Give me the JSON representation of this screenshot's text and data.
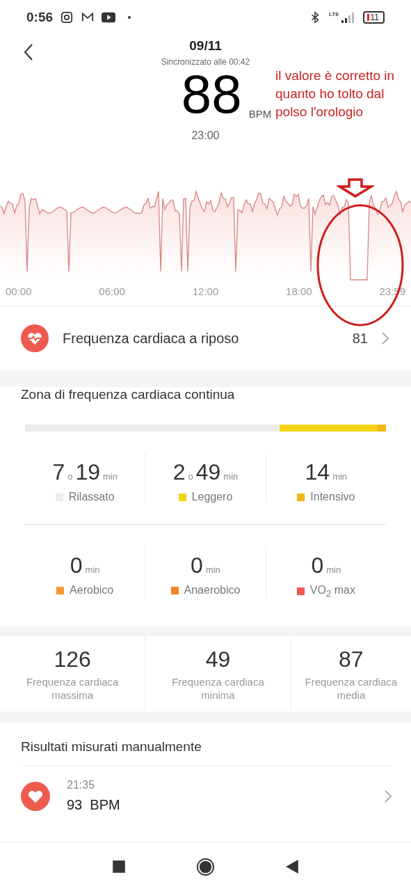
{
  "status_bar": {
    "time": "0:56",
    "network": "LTE",
    "battery": "11"
  },
  "header": {
    "date": "09/11",
    "sync": "Sincronizzato alle 00:42",
    "bpm": "88",
    "unit": "BPM",
    "time": "23:00"
  },
  "annotation": {
    "text": "il valore è corretto in quanto ho tolto dal polso l'orologio"
  },
  "chart": {
    "x_labels": [
      "00:00",
      "06:00",
      "12:00",
      "18:00",
      "23:59"
    ]
  },
  "resting": {
    "label": "Frequenza cardiaca a riposo",
    "value": "81"
  },
  "zones": {
    "title": "Zona di frequenza cardiaca continua",
    "items": [
      {
        "label": "Rilassato",
        "color": "#ececec",
        "parts": [
          {
            "kind": "number",
            "text": "7"
          },
          {
            "kind": "unit",
            "text": "o"
          },
          {
            "kind": "number",
            "text": "19"
          },
          {
            "kind": "unit",
            "text": "min"
          }
        ]
      },
      {
        "label": "Leggero",
        "color": "#f5d415",
        "parts": [
          {
            "kind": "number",
            "text": "2"
          },
          {
            "kind": "unit",
            "text": "o"
          },
          {
            "kind": "number",
            "text": "49"
          },
          {
            "kind": "unit",
            "text": "min"
          }
        ]
      },
      {
        "label": "Intensivo",
        "color": "#f2b818",
        "parts": [
          {
            "kind": "number",
            "text": "14"
          },
          {
            "kind": "unit",
            "text": "min"
          }
        ]
      },
      {
        "label": "Aerobico",
        "color": "#f59a32",
        "parts": [
          {
            "kind": "number",
            "text": "0"
          },
          {
            "kind": "unit",
            "text": "min"
          }
        ]
      },
      {
        "label": "Anaerobico",
        "color": "#f28424",
        "parts": [
          {
            "kind": "number",
            "text": "0"
          },
          {
            "kind": "unit",
            "text": "min"
          }
        ]
      },
      {
        "label": "VO$_{2}$ max",
        "color": "#ee5a4e",
        "parts": [
          {
            "kind": "number",
            "text": "0"
          },
          {
            "kind": "unit",
            "text": "min"
          }
        ]
      }
    ]
  },
  "stats": [
    {
      "value": "126",
      "label": "Frequenza cardiaca massima"
    },
    {
      "value": "49",
      "label": "Frequenza cardiaca minima"
    },
    {
      "value": "87",
      "label": "Frequenza cardiaca media"
    }
  ],
  "manual": {
    "title": "Risultati misurati manualmente",
    "items": [
      {
        "time": "21:35",
        "value": "93  BPM"
      }
    ]
  }
}
